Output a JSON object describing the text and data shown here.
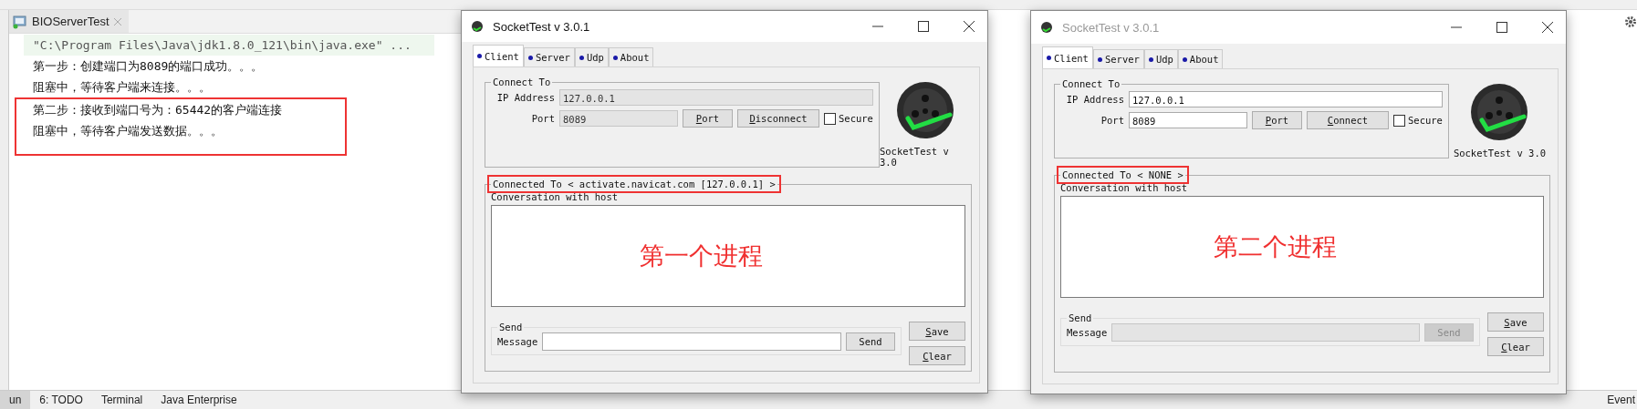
{
  "ide": {
    "run_tab": {
      "title": "BIOServerTest"
    },
    "console": {
      "command": "\"C:\\Program Files\\Java\\jdk1.8.0_121\\bin\\java.exe\" ...",
      "lines": [
        "第一步：创建端口为8089的端口成功。。。",
        "阻塞中，等待客户端来连接。。。"
      ],
      "annotated_lines": [
        "第二步：接收到端口号为：65442的客户端连接",
        "阻塞中，等待客户端发送数据。。。"
      ]
    },
    "bottom_tabs": [
      {
        "label": "un",
        "selected": true
      },
      {
        "label": "6: TODO",
        "selected": false
      },
      {
        "label": "Terminal",
        "selected": false
      },
      {
        "label": "Java Enterprise",
        "selected": false
      }
    ],
    "event_label": "Event"
  },
  "windows": [
    {
      "title": "SocketTest v 3.0.1",
      "active": true,
      "tabs": [
        {
          "label": "Client",
          "selected": true
        },
        {
          "label": "Server",
          "selected": false
        },
        {
          "label": "Udp",
          "selected": false
        },
        {
          "label": "About",
          "selected": false
        }
      ],
      "connect_group": "Connect To",
      "ip_label": "IP Address",
      "ip": "127.0.0.1",
      "ip_disabled": true,
      "port_label": "Port",
      "port": "8089",
      "port_disabled": true,
      "port_button": "Port",
      "connect_button": "Disconnect",
      "secure": {
        "label": "Secure",
        "checked": false
      },
      "logo_caption": "SocketTest v 3.0",
      "connected_label": "Connected To <  activate.navicat.com [127.0.0.1]  >",
      "connected_annotated": true,
      "conversation_label": "Conversation with host",
      "annotation": "第一个进程",
      "send_group": "Send",
      "message_label": "Message",
      "message_disabled": false,
      "send_button": "Send",
      "send_disabled": false,
      "save_button": "Save",
      "clear_button": "Clear"
    },
    {
      "title": "SocketTest v 3.0.1",
      "active": false,
      "tabs": [
        {
          "label": "Client",
          "selected": true
        },
        {
          "label": "Server",
          "selected": false
        },
        {
          "label": "Udp",
          "selected": false
        },
        {
          "label": "About",
          "selected": false
        }
      ],
      "connect_group": "Connect To",
      "ip_label": "IP Address",
      "ip": "127.0.0.1",
      "ip_disabled": false,
      "port_label": "Port",
      "port": "8089",
      "port_disabled": false,
      "port_button": "Port",
      "connect_button": "Connect",
      "secure": {
        "label": "Secure",
        "checked": false
      },
      "logo_caption": "SocketTest v 3.0",
      "connected_label": "Connected To < NONE >",
      "connected_annotated": true,
      "conversation_label": "Conversation with host",
      "annotation": "第二个进程",
      "send_group": "Send",
      "message_label": "Message",
      "message_disabled": true,
      "send_button": "Send",
      "send_disabled": true,
      "save_button": "Save",
      "clear_button": "Clear"
    }
  ]
}
